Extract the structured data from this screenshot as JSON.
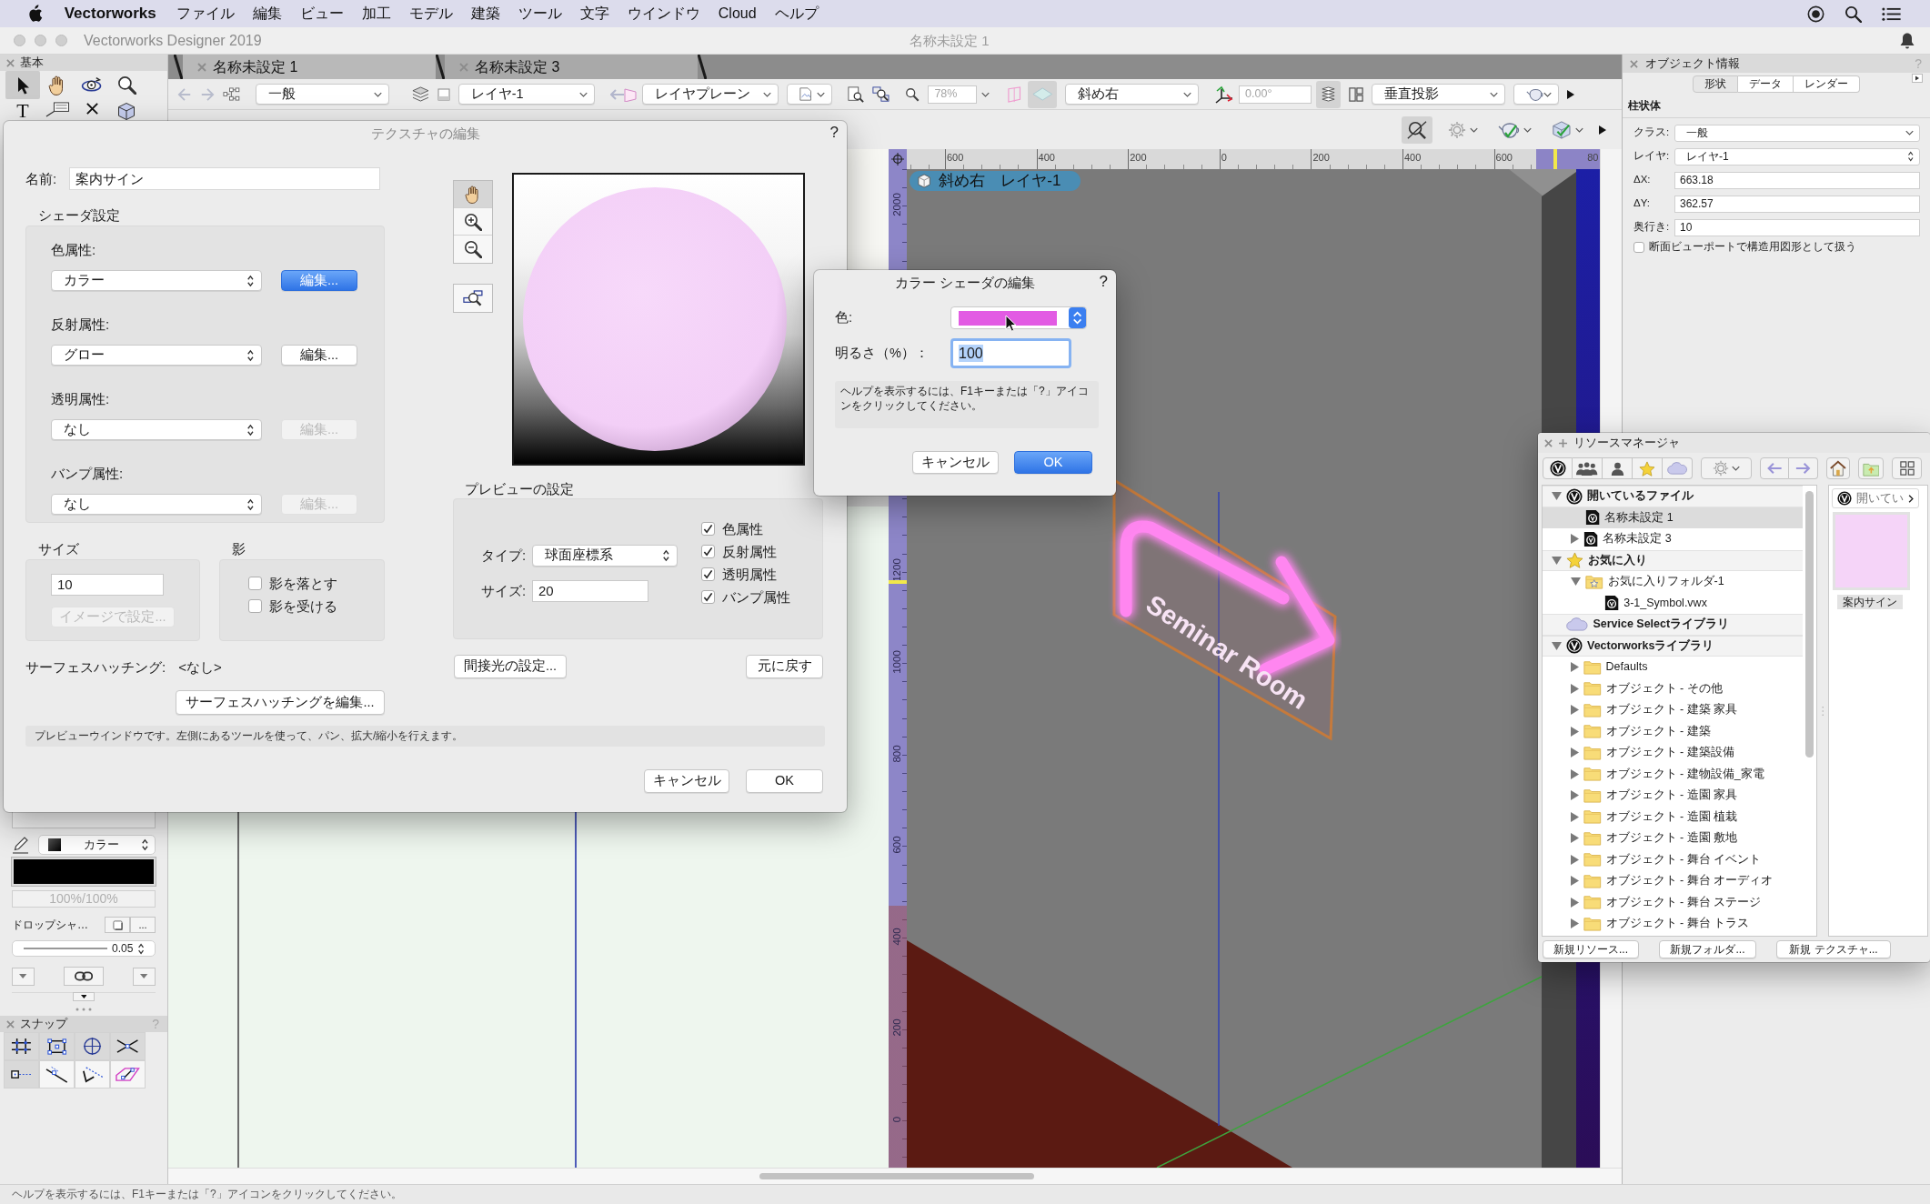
{
  "menu_bar": {
    "app_name": "Vectorworks",
    "items": [
      "ファイル",
      "編集",
      "ビュー",
      "加工",
      "モデル",
      "建築",
      "ツール",
      "文字",
      "ウインドウ",
      "Cloud",
      "ヘルプ"
    ]
  },
  "window": {
    "app_title": "Vectorworks Designer 2019",
    "title": "名称未設定 1"
  },
  "basic_palette": {
    "title": "基本",
    "tools": [
      {
        "kind": "pointer",
        "selected": true
      },
      {
        "kind": "pan",
        "selected": false
      },
      {
        "kind": "flyover",
        "selected": false
      },
      {
        "kind": "zoom",
        "selected": false
      },
      {
        "kind": "text",
        "label": "T",
        "selected": false
      },
      {
        "kind": "callout",
        "selected": false
      },
      {
        "kind": "locus",
        "selected": false
      },
      {
        "kind": "push-pull",
        "selected": false
      }
    ]
  },
  "attributes": {
    "line_style": "カラー",
    "opacity": "100%/100%",
    "drop_shadow": "ドロップシャ…",
    "drop_shadow_more": "...",
    "line_weight": "0.05"
  },
  "snap_palette": {
    "title": "スナップ",
    "help": "?",
    "tools": [
      {
        "kind": "grid",
        "on": true
      },
      {
        "kind": "object",
        "on": true
      },
      {
        "kind": "angle",
        "on": true
      },
      {
        "kind": "intersection",
        "on": true
      },
      {
        "kind": "distance",
        "on": true
      },
      {
        "kind": "line",
        "on": false
      },
      {
        "kind": "tangent",
        "on": false
      },
      {
        "kind": "working-plane",
        "on": false
      }
    ]
  },
  "document_tabs": [
    {
      "label": "名称未設定 1",
      "selected": true
    },
    {
      "label": "名称未設定 3",
      "selected": false
    }
  ],
  "view_bar": {
    "class": "一般",
    "layer": "レイヤ-1",
    "plane": "レイヤプレーン",
    "zoom": "78%",
    "view": "斜め右",
    "rotation": "0.00°",
    "projection": "垂直投影"
  },
  "canvas": {
    "view_name": "斜め右",
    "layer_name": "レイヤ-1",
    "top_ruler": [
      "600",
      "400",
      "200",
      "0",
      "200",
      "400",
      "600",
      "80"
    ],
    "left_ruler": [
      "2000",
      "1200",
      "1000",
      "800",
      "600",
      "400",
      "200",
      "0"
    ],
    "sign_text": "Seminar Room"
  },
  "object_info": {
    "title": "オブジェクト情報",
    "help": "?",
    "tabs": [
      {
        "label": "形状",
        "selected": true
      },
      {
        "label": "データ",
        "selected": false
      },
      {
        "label": "レンダー",
        "selected": false
      }
    ],
    "object_type": "柱状体",
    "fields": [
      {
        "kind": "dropdown",
        "label": "クラス:",
        "value": "一般"
      },
      {
        "kind": "popup",
        "label": "レイヤ:",
        "value": "レイヤ-1"
      },
      {
        "kind": "input",
        "label": "ΔX:",
        "value": "663.18"
      },
      {
        "kind": "input",
        "label": "ΔY:",
        "value": "362.57"
      },
      {
        "kind": "input",
        "label": "奥行き:",
        "value": "10"
      }
    ],
    "options": [
      {
        "label": "断面ビューポートで構造用図形として扱う",
        "checked": false
      }
    ]
  },
  "texture_dialog": {
    "title": "テクスチャの編集",
    "help": "?",
    "name_label": "名前:",
    "name": "案内サイン",
    "shader_heading": "シェーダ設定",
    "shaders": [
      {
        "label": "色属性:",
        "value": "カラー",
        "button": "編集...",
        "default": true,
        "disabled": false
      },
      {
        "label": "反射属性:",
        "value": "グロー",
        "button": "編集...",
        "default": false,
        "disabled": false
      },
      {
        "label": "透明属性:",
        "value": "なし",
        "button": "編集...",
        "default": false,
        "disabled": true
      },
      {
        "label": "バンプ属性:",
        "value": "なし",
        "button": "編集...",
        "default": false,
        "disabled": true
      }
    ],
    "size_heading": "サイズ",
    "size": "10",
    "size_button": "イメージで設定...",
    "size_button_disabled": true,
    "shadow_heading": "影",
    "shadow_options": [
      {
        "label": "影を落とす",
        "checked": false
      },
      {
        "label": "影を受ける",
        "checked": false
      }
    ],
    "hatch_label": "サーフェスハッチング:",
    "hatch_value": "<なし>",
    "hatch_button": "サーフェスハッチングを編集...",
    "preview_tools": [
      {
        "kind": "pan",
        "selected": true
      },
      {
        "kind": "zoom-in",
        "selected": false
      },
      {
        "kind": "zoom-out",
        "selected": false
      },
      {
        "kind": "zoom-window",
        "selected": false
      }
    ],
    "preview_heading": "プレビューの設定",
    "type_label": "タイプ:",
    "type": "球面座標系",
    "preview_size_label": "サイズ:",
    "preview_size": "20",
    "preview_options": [
      {
        "label": "色属性",
        "checked": true
      },
      {
        "label": "反射属性",
        "checked": true
      },
      {
        "label": "透明属性",
        "checked": true
      },
      {
        "label": "バンプ属性",
        "checked": true
      }
    ],
    "light_button": "間接光の設定...",
    "revert_button": "元に戻す",
    "hint": "プレビューウインドウです。左側にあるツールを使って、パン、拡大/縮小を行えます。",
    "cancel": "キャンセル",
    "ok": "OK"
  },
  "color_shader_dialog": {
    "title": "カラー シェーダの編集",
    "help": "?",
    "color_label": "色:",
    "color": "#e25be3",
    "brightness_label": "明るさ（%）：",
    "brightness": "100",
    "hint": "ヘルプを表示するには、F1キーまたは「?」アイコンをクリックしてください。",
    "cancel": "キャンセル",
    "ok": "OK"
  },
  "resource_manager": {
    "title": "リソースマネージャ",
    "tree": [
      {
        "kind": "open-files",
        "label": "開いているファイル",
        "expanded": true,
        "selected": false,
        "children": [
          {
            "kind": "document",
            "label": "名称未設定 1",
            "selected": true
          },
          {
            "kind": "document",
            "label": "名称未設定 3",
            "expanded": false,
            "selected": false
          }
        ]
      },
      {
        "kind": "favorites",
        "label": "お気に入り",
        "expanded": true,
        "selected": false,
        "children": [
          {
            "kind": "favorite-folder",
            "label": "お気に入りフォルダ-1",
            "expanded": true,
            "selected": false,
            "children": [
              {
                "kind": "document",
                "label": "3-1_Symbol.vwx",
                "selected": false
              }
            ]
          }
        ]
      },
      {
        "kind": "cloud",
        "label": "Service Selectライブラリ",
        "selected": false
      },
      {
        "kind": "library",
        "label": "Vectorworksライブラリ",
        "expanded": true,
        "selected": false,
        "children": [
          {
            "kind": "folder",
            "label": "Defaults",
            "expanded": false,
            "selected": false
          },
          {
            "kind": "folder",
            "label": "オブジェクト - その他",
            "expanded": false,
            "selected": false
          },
          {
            "kind": "folder",
            "label": "オブジェクト - 建築 家具",
            "expanded": false,
            "selected": false
          },
          {
            "kind": "folder",
            "label": "オブジェクト - 建築",
            "expanded": false,
            "selected": false
          },
          {
            "kind": "folder",
            "label": "オブジェクト - 建築設備",
            "expanded": false,
            "selected": false
          },
          {
            "kind": "folder",
            "label": "オブジェクト - 建物設備_家電",
            "expanded": false,
            "selected": false
          },
          {
            "kind": "folder",
            "label": "オブジェクト - 造園 家具",
            "expanded": false,
            "selected": false
          },
          {
            "kind": "folder",
            "label": "オブジェクト - 造園 植栽",
            "expanded": false,
            "selected": false
          },
          {
            "kind": "folder",
            "label": "オブジェクト - 造園 敷地",
            "expanded": false,
            "selected": false
          },
          {
            "kind": "folder",
            "label": "オブジェクト - 舞台 イベント",
            "expanded": false,
            "selected": false
          },
          {
            "kind": "folder",
            "label": "オブジェクト - 舞台 オーディオ",
            "expanded": false,
            "selected": false
          },
          {
            "kind": "folder",
            "label": "オブジェクト - 舞台 ステージ",
            "expanded": false,
            "selected": false
          },
          {
            "kind": "folder",
            "label": "オブジェクト - 舞台 トラス",
            "expanded": false,
            "selected": false
          }
        ]
      }
    ],
    "breadcrumb": "開いてい",
    "thumbnail_label": "案内サイン",
    "buttons": [
      "新規リソース...",
      "新規フォルダ...",
      "新規 テクスチャ..."
    ]
  },
  "status_bar": {
    "text": "ヘルプを表示するには、F1キーまたは「?」アイコンをクリックしてください。"
  }
}
